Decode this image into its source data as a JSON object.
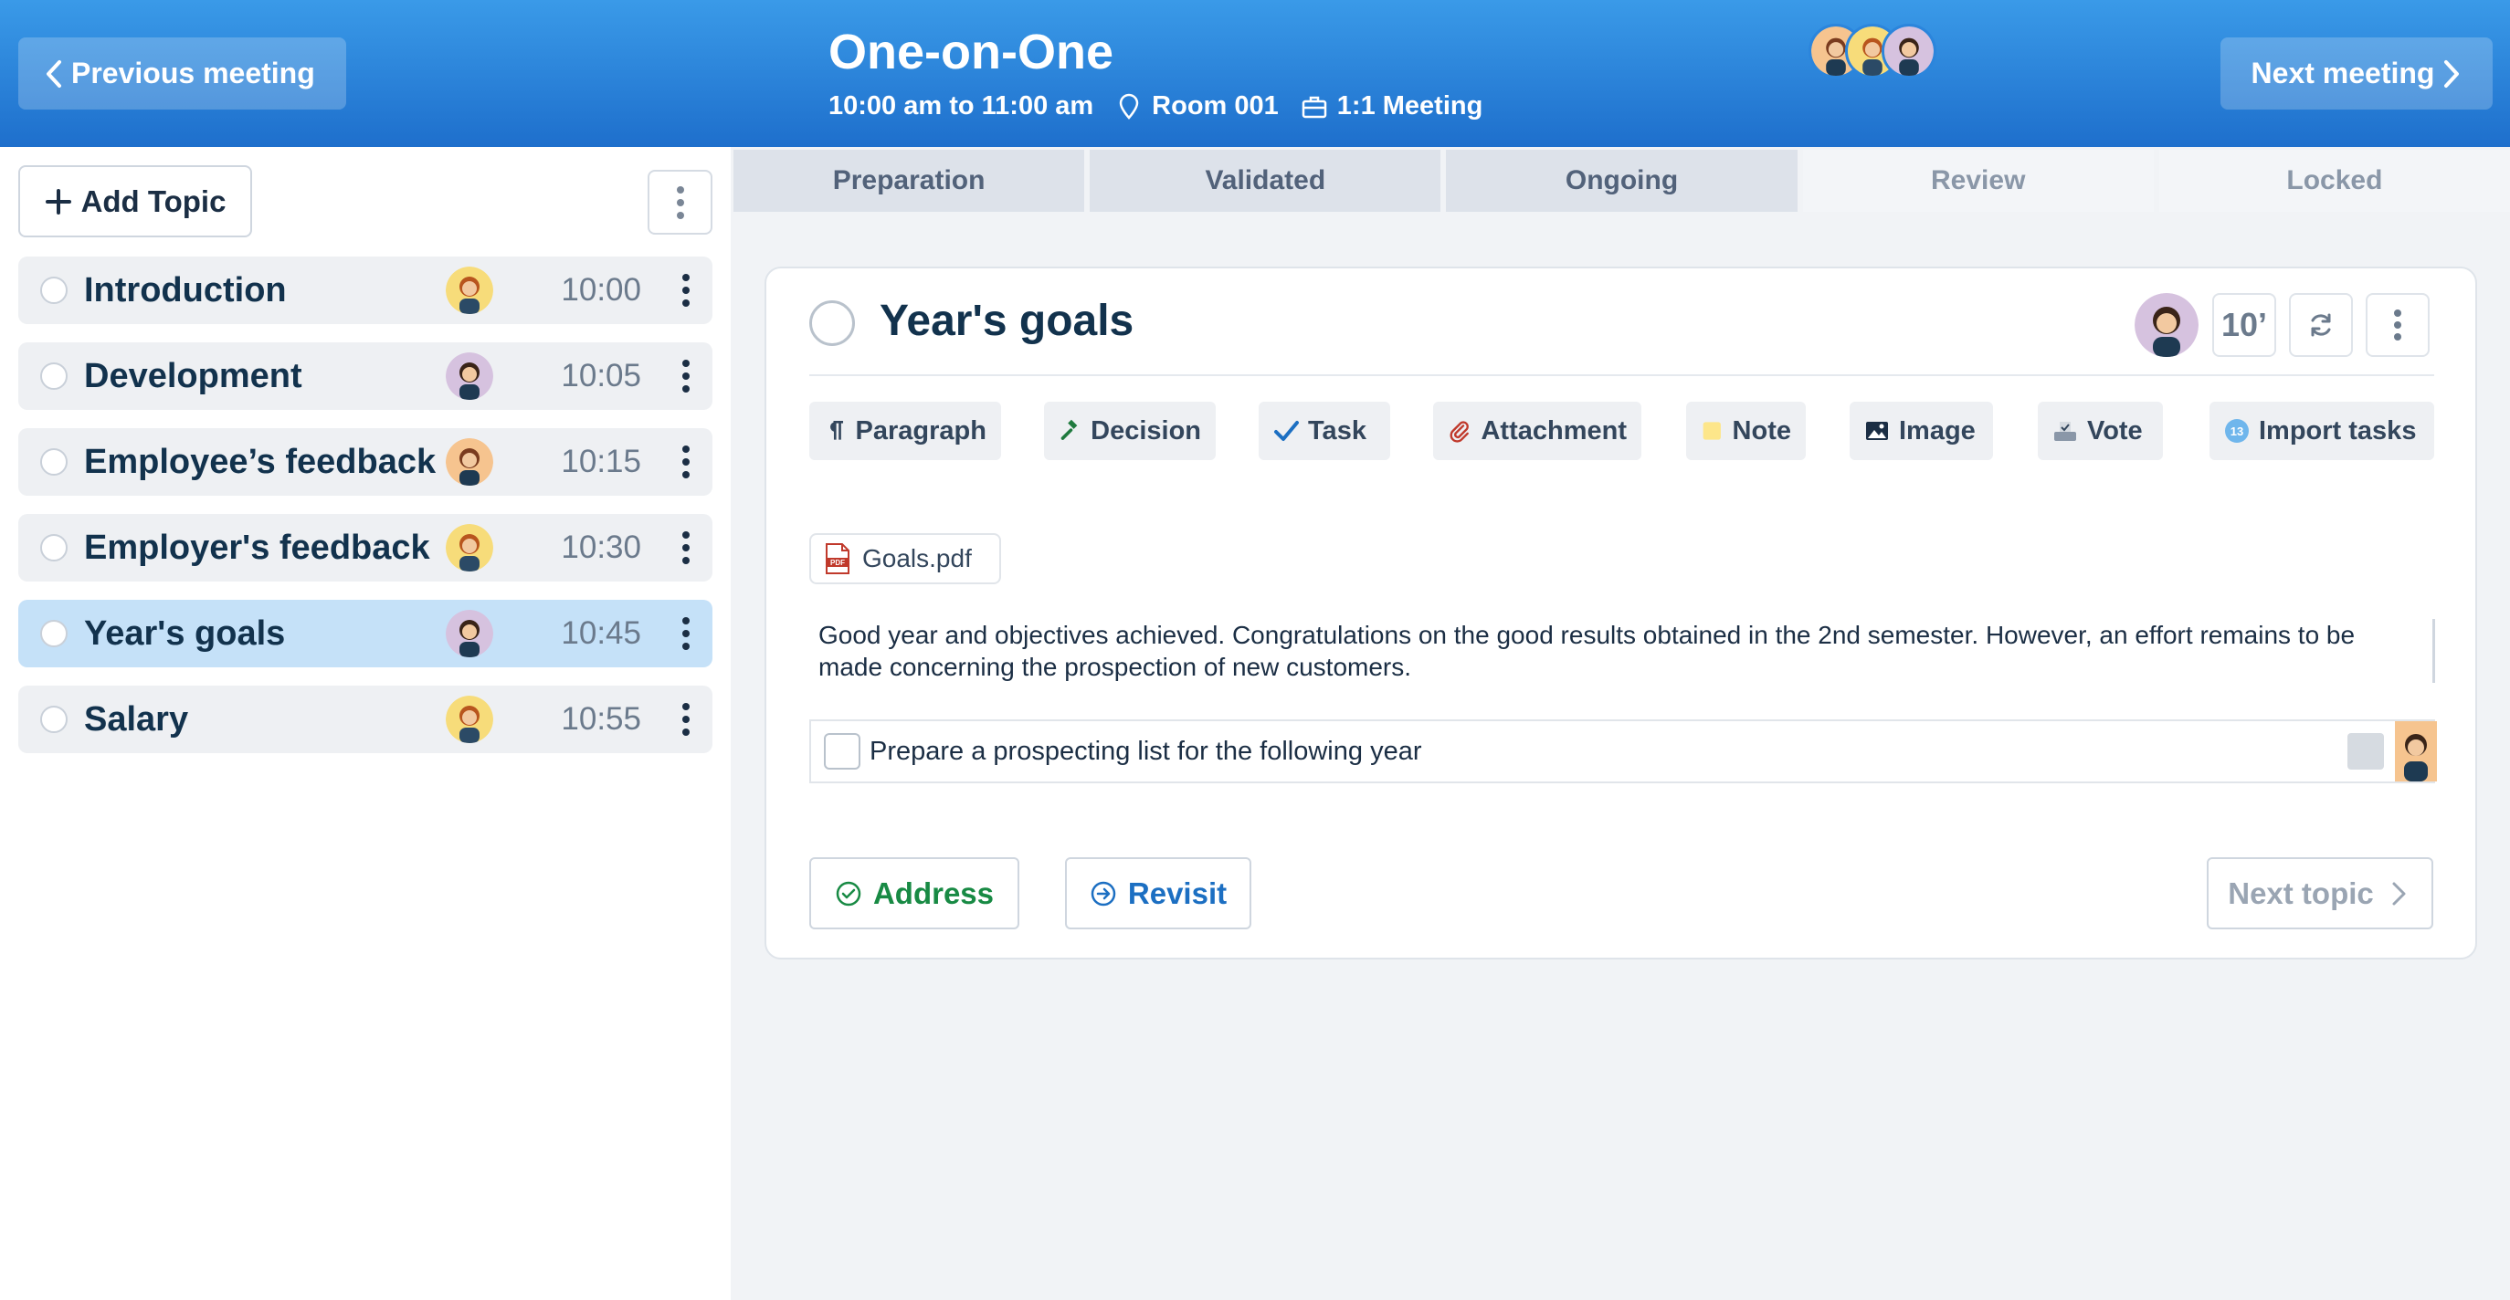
{
  "header": {
    "prev_label": "Previous meeting",
    "next_label": "Next meeting",
    "title": "One-on-One",
    "time": "10:00 am to 11:00 am",
    "room": "Room 001",
    "type": "1:1 Meeting"
  },
  "sidebar": {
    "add_topic_label": "Add Topic",
    "topics": [
      {
        "name": "Introduction",
        "time": "10:00"
      },
      {
        "name": "Development",
        "time": "10:05"
      },
      {
        "name": "Employee’s feedback",
        "time": "10:15"
      },
      {
        "name": "Employer's feedback",
        "time": "10:30"
      },
      {
        "name": "Year's goals",
        "time": "10:45"
      },
      {
        "name": "Salary",
        "time": "10:55"
      }
    ]
  },
  "tabs": [
    "Preparation",
    "Validated",
    "Ongoing",
    "Review",
    "Locked"
  ],
  "topic": {
    "title": "Year's goals",
    "duration": "10’",
    "toolbar": [
      "Paragraph",
      "Decision",
      "Task",
      "Attachment",
      "Note",
      "Image",
      "Vote",
      "Import tasks"
    ],
    "import_count": "13",
    "attachment_name": "Goals.pdf",
    "paragraph": "Good year and objectives achieved. Congratulations on the good results obtained in the 2nd semester. However, an effort remains to be made concerning the prospection of new customers.",
    "task_label": "Prepare a prospecting list for the following year",
    "address_label": "Address",
    "revisit_label": "Revisit",
    "next_topic_label": "Next topic"
  },
  "colors": {
    "header_top": "#3a9ae8",
    "header_bottom": "#1e6fcc",
    "active_topic": "#c5e1f8",
    "address_green": "#188a44",
    "revisit_blue": "#1c6fc2"
  }
}
